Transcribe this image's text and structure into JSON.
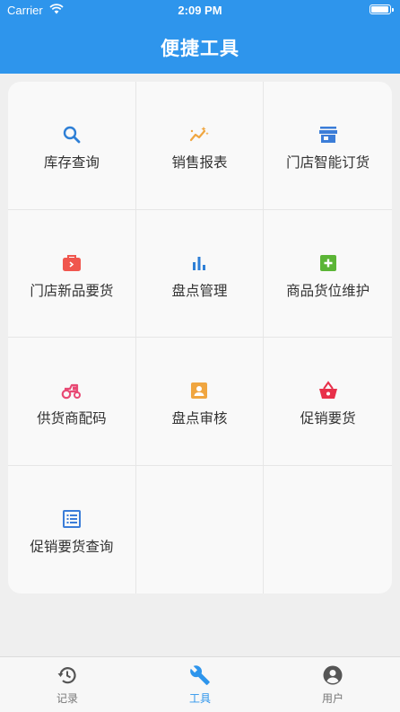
{
  "status_bar": {
    "carrier": "Carrier",
    "time": "2:09 PM",
    "battery_level": 1.0
  },
  "header": {
    "title": "便捷工具"
  },
  "tools": [
    {
      "label": "库存查询",
      "icon": "search-icon",
      "color": "#2e7fd6"
    },
    {
      "label": "销售报表",
      "icon": "trend-chart-icon",
      "color": "#f0a640"
    },
    {
      "label": "门店智能订货",
      "icon": "store-icon",
      "color": "#3b7dd8"
    },
    {
      "label": "门店新品要货",
      "icon": "briefcase-icon",
      "color": "#f0564e"
    },
    {
      "label": "盘点管理",
      "icon": "bar-chart-icon",
      "color": "#2e7fd6"
    },
    {
      "label": "商品货位维护",
      "icon": "add-box-icon",
      "color": "#5bb536"
    },
    {
      "label": "供货商配码",
      "icon": "tractor-icon",
      "color": "#e84a74"
    },
    {
      "label": "盘点审核",
      "icon": "contact-card-icon",
      "color": "#f0a640"
    },
    {
      "label": "促销要货",
      "icon": "basket-icon",
      "color": "#e8304a"
    },
    {
      "label": "促销要货查询",
      "icon": "list-icon",
      "color": "#3b7dd8"
    }
  ],
  "tabbar": {
    "items": [
      {
        "label": "记录",
        "icon": "history-icon",
        "active": false
      },
      {
        "label": "工具",
        "icon": "wrench-icon",
        "active": true
      },
      {
        "label": "用户",
        "icon": "user-icon",
        "active": false
      }
    ],
    "active_color": "#2e95ec",
    "inactive_color": "#555555"
  }
}
